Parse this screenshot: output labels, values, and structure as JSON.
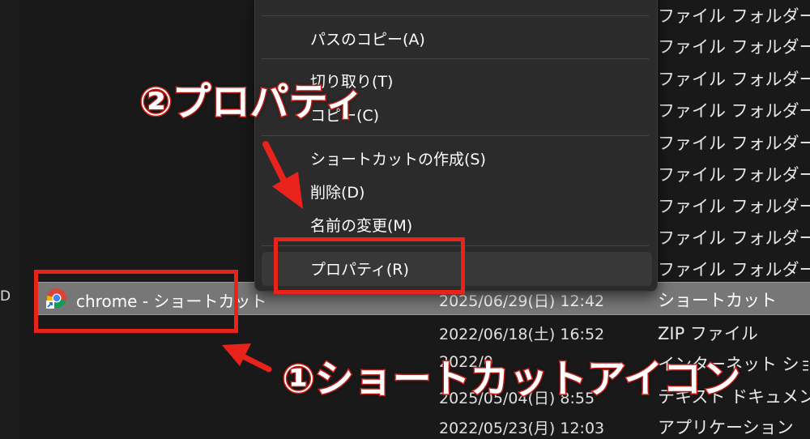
{
  "sidebar": {
    "partial_text": "D"
  },
  "file_list": {
    "folder_type": "ファイル フォルダー",
    "folder_row_count": 9,
    "rows": [
      {
        "name": "chrome - ショートカット",
        "date": "2025/06/29(日) 12:42",
        "type": "ショートカット",
        "selected": true
      },
      {
        "name": "",
        "date": "2022/06/18(土) 16:52",
        "type": "ZIP ファイル"
      },
      {
        "name": "",
        "date": "2022/0",
        "type": "インターネット ショートカット"
      },
      {
        "name": "",
        "date": "2025/05/04(日) 8:55",
        "type": "テキスト ドキュメント"
      },
      {
        "name": "",
        "date": "2022/05/23(月) 12:03",
        "type": "アプリケーション"
      }
    ]
  },
  "context_menu": {
    "items": [
      {
        "label": "パスのコピー(A)"
      },
      {
        "label": "切り取り(T)"
      },
      {
        "label": "コピー(C)"
      },
      {
        "label": "ショートカットの作成(S)"
      },
      {
        "label": "削除(D)"
      },
      {
        "label": "名前の変更(M)"
      },
      {
        "label": "プロパティ(R)"
      }
    ]
  },
  "annotations": {
    "label_1": "①ショートカットアイコン",
    "label_2": "②プロパティ",
    "color": "#e8231c"
  }
}
